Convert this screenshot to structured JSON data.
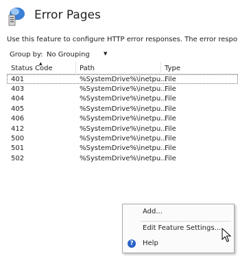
{
  "header": {
    "title": "Error Pages",
    "icon": "server-page-icon"
  },
  "description": "Use this feature to configure HTTP error responses. The error responses can be",
  "group_by": {
    "label": "Group by:",
    "value": "No Grouping"
  },
  "table": {
    "columns": [
      "Status Code",
      "Path",
      "Type"
    ],
    "rows": [
      {
        "status": "401",
        "path": "%SystemDrive%\\inetpu...",
        "type": "File"
      },
      {
        "status": "403",
        "path": "%SystemDrive%\\inetpu...",
        "type": "File"
      },
      {
        "status": "404",
        "path": "%SystemDrive%\\inetpu...",
        "type": "File"
      },
      {
        "status": "405",
        "path": "%SystemDrive%\\inetpu...",
        "type": "File"
      },
      {
        "status": "406",
        "path": "%SystemDrive%\\inetpu...",
        "type": "File"
      },
      {
        "status": "412",
        "path": "%SystemDrive%\\inetpu...",
        "type": "File"
      },
      {
        "status": "500",
        "path": "%SystemDrive%\\inetpu...",
        "type": "File"
      },
      {
        "status": "501",
        "path": "%SystemDrive%\\inetpu...",
        "type": "File"
      },
      {
        "status": "502",
        "path": "%SystemDrive%\\inetpu...",
        "type": "File"
      }
    ]
  },
  "context_menu": {
    "items": [
      {
        "label": "Add..."
      },
      {
        "label": "Edit Feature Settings..."
      },
      {
        "label": "Help",
        "icon": "help-icon"
      }
    ]
  },
  "colors": {
    "help_icon": "#2a62c9",
    "menu_border": "#a8a8a8"
  }
}
